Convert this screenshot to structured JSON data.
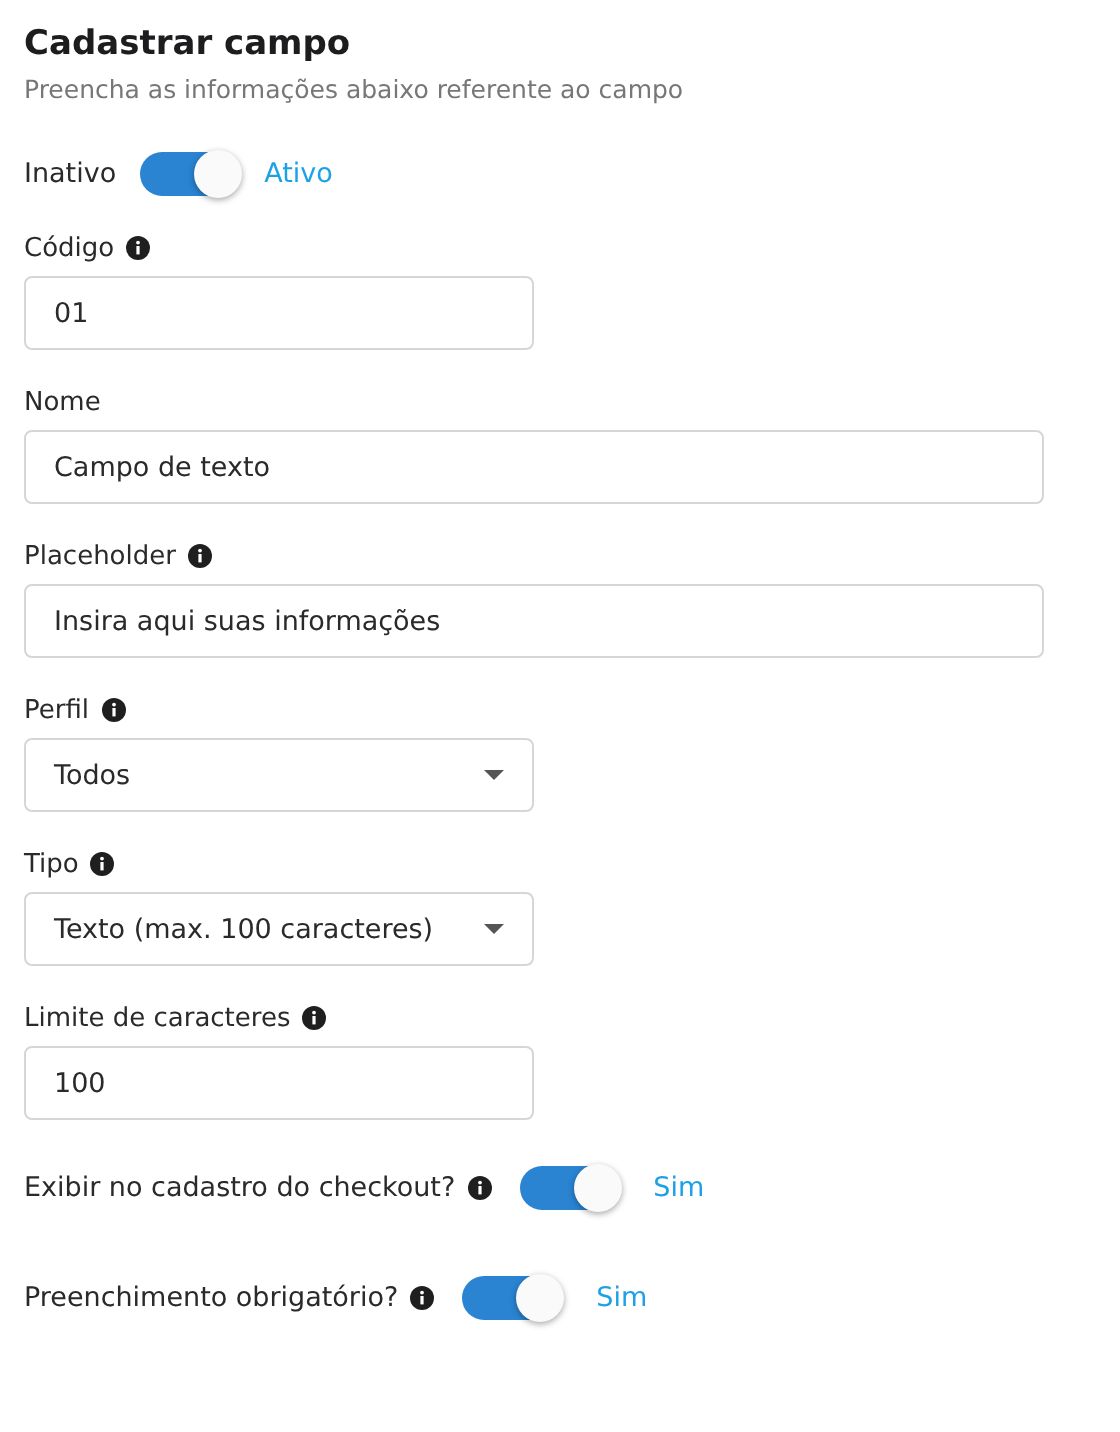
{
  "header": {
    "title": "Cadastrar campo",
    "subtitle": "Preencha as informações abaixo referente ao campo"
  },
  "status_toggle": {
    "off_label": "Inativo",
    "on_label": "Ativo",
    "on": true
  },
  "fields": [
    {
      "label": "Código",
      "info": true,
      "kind": "text",
      "value": "01"
    },
    {
      "label": "Nome",
      "info": false,
      "kind": "text",
      "value": "Campo de texto"
    },
    {
      "label": "Placeholder",
      "info": true,
      "kind": "text",
      "value": "Insira aqui suas informações"
    },
    {
      "label": "Perfil",
      "info": true,
      "kind": "select",
      "value": "Todos"
    },
    {
      "label": "Tipo",
      "info": true,
      "kind": "select",
      "value": "Texto (max. 100 caracteres)"
    },
    {
      "label": "Limite de caracteres",
      "info": true,
      "kind": "text",
      "value": "100"
    }
  ],
  "options": [
    {
      "label": "Exibir no cadastro do checkout?",
      "info": true,
      "on": true,
      "state_label": "Sim"
    },
    {
      "label": "Preenchimento obrigatório?",
      "info": true,
      "on": true,
      "state_label": "Sim"
    }
  ]
}
